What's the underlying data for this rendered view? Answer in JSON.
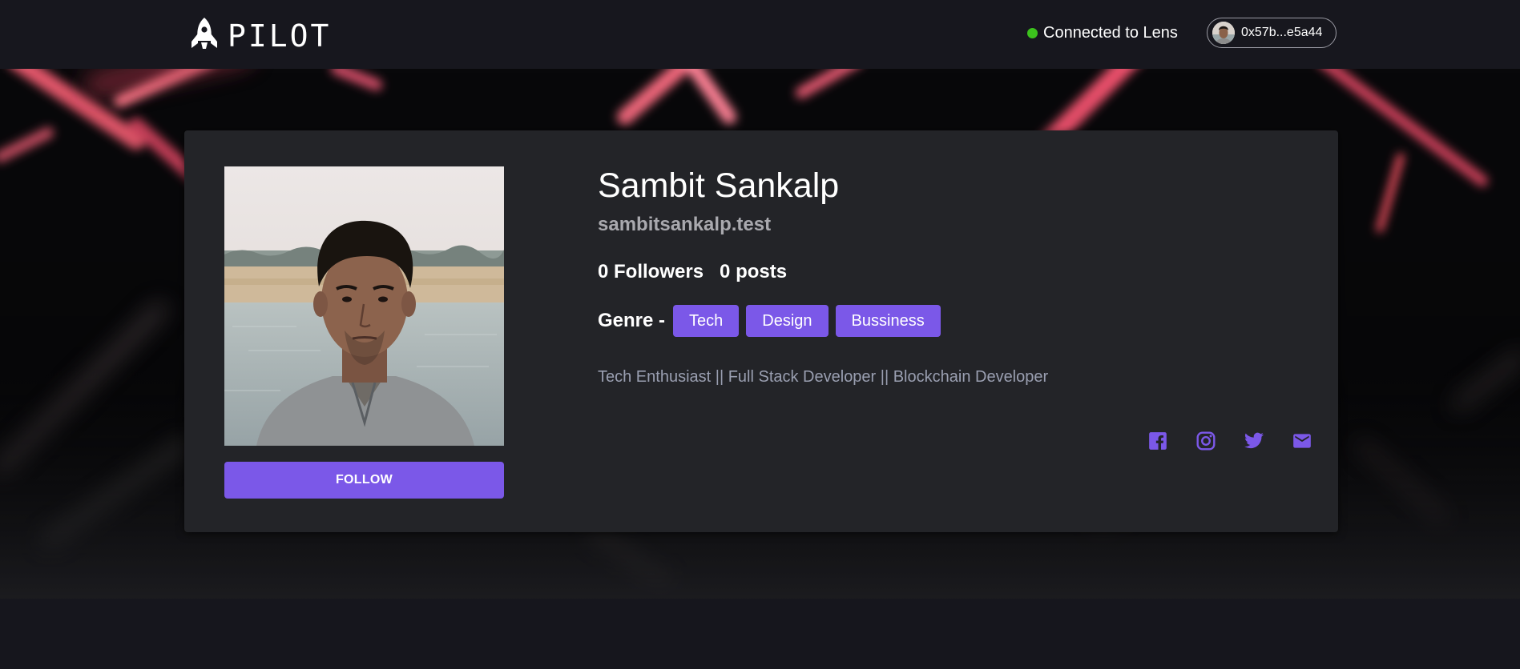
{
  "header": {
    "logo_text": "PILOT",
    "status_text": "Connected to Lens",
    "status_color": "#3cc21d",
    "wallet_address": "0x57b...e5a44"
  },
  "profile": {
    "name": "Sambit Sankalp",
    "handle": "sambitsankalp.test",
    "followers_label": "0 Followers",
    "posts_label": "0 posts",
    "genre_label": "Genre -",
    "genres": [
      "Tech",
      "Design",
      "Bussiness"
    ],
    "bio": "Tech Enthusiast || Full Stack Developer || Blockchain Developer",
    "follow_label": "FOLLOW"
  },
  "socials": [
    "facebook-icon",
    "instagram-icon",
    "twitter-icon",
    "email-icon"
  ],
  "colors": {
    "accent": "#7b58e8",
    "card": "#232428",
    "header": "#17171e"
  }
}
